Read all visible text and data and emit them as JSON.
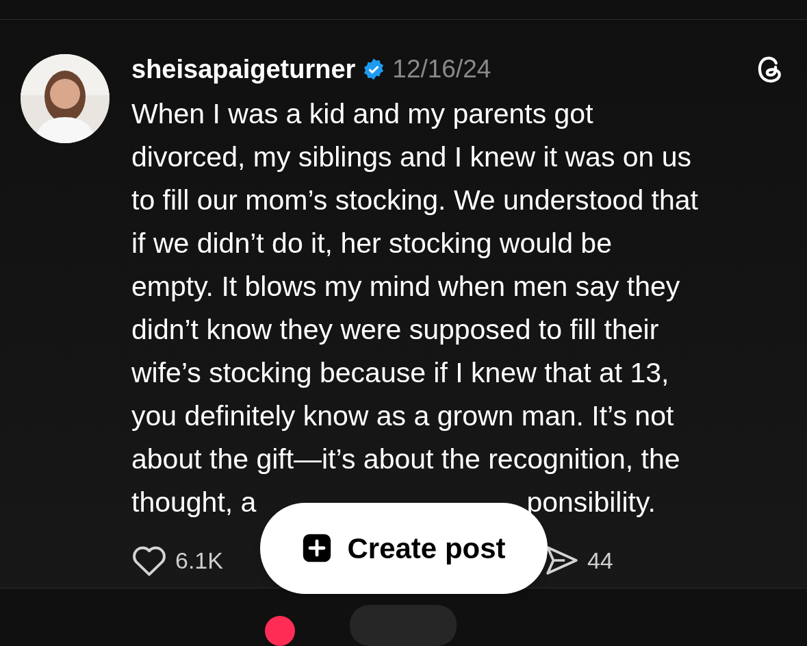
{
  "post": {
    "author": "sheisapaigeturner",
    "verified": true,
    "date": "12/16/24",
    "body": [
      "When I was a kid and my parents got",
      "divorced, my siblings and I knew it was on us",
      "to fill our mom’s stocking. We understood that",
      "if we didn’t do it, her stocking would be",
      "empty. It blows my mind when men say they",
      "didn’t know they were supposed to fill their",
      "wife’s stocking because if I knew that at 13,",
      "you definitely know as a grown man. It’s not",
      "about the gift—it’s about the recognition, the"
    ],
    "body_visible_end": [
      "thought, a",
      "ponsibility."
    ],
    "actions": [
      {
        "kind": "like",
        "count": "6.1K"
      },
      {
        "kind": "share",
        "count": "44"
      }
    ]
  },
  "create_button": {
    "label": "Create post"
  }
}
